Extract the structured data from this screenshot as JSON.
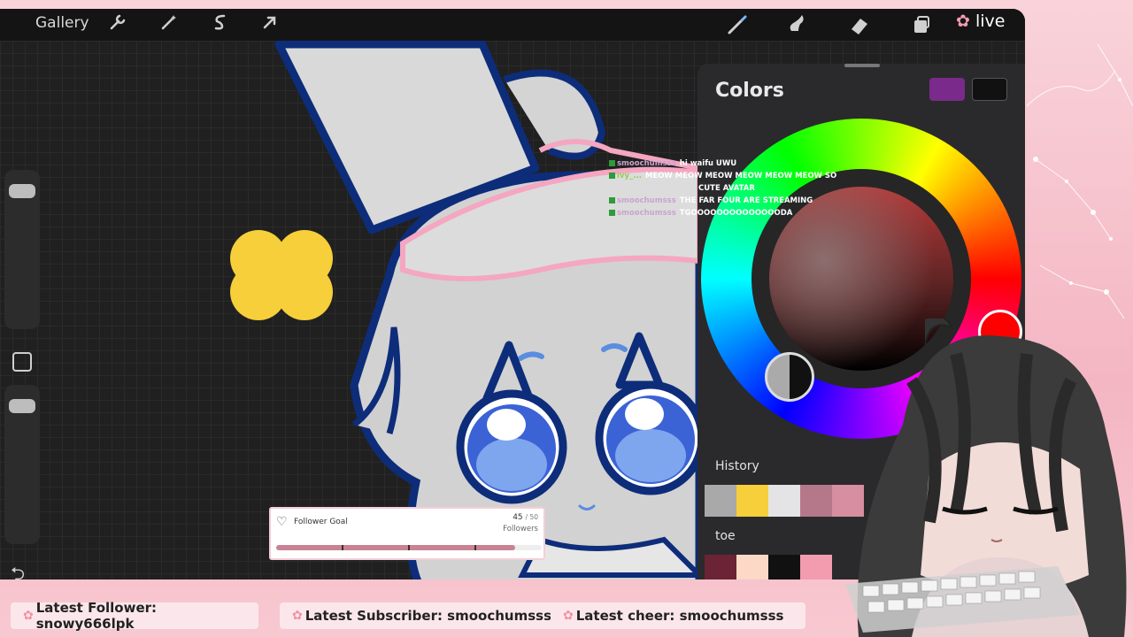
{
  "app": {
    "gallery_label": "Gallery",
    "live_label": "live",
    "live_flower": "✿"
  },
  "toolbar": {
    "left_icons": [
      "wrench-icon",
      "magic-wand-icon",
      "selection-icon",
      "transform-arrow-icon"
    ],
    "right_icons": [
      "brush-icon",
      "smudge-icon",
      "eraser-icon",
      "layers-icon"
    ]
  },
  "colors_panel": {
    "title": "Colors",
    "current_primary": "#7a2a8a",
    "current_secondary": "#111111",
    "history_label": "History",
    "history_swatches": [
      "#a9a9a9",
      "#f6cf3a",
      "#e4e4e6",
      "#b5788a",
      "#d68ea0"
    ],
    "palette_label": "toe",
    "palette_swatches": [
      "#6b2336",
      "#fbd9c6",
      "#111111",
      "#f39cb0"
    ]
  },
  "chat": [
    {
      "user": "smoochumsss",
      "message": "hi waifu UWU"
    },
    {
      "user": "ivy_...",
      "message": "MEOW MEOW MEOW MEOW MEOW MEOW SO"
    },
    {
      "user": "",
      "message": "CUTE AVATAR"
    },
    {
      "user": "smoochumsss",
      "message": "THE FAR FOUR ARE STREAMING"
    },
    {
      "user": "smoochumsss",
      "message": "TGOOOOOOOOOOOOOODA"
    }
  ],
  "follower_goal": {
    "title": "Follower Goal",
    "current": "45",
    "target": "/ 50",
    "unit": "Followers",
    "progress_fraction": 0.9
  },
  "ticker": {
    "latest_follower": "Latest Follower: snowy666lpk",
    "latest_subscriber": "Latest Subscriber: smoochumsss",
    "latest_cheer": "Latest cheer: smoochumsss"
  },
  "colors": {
    "accent_pink": "#f4b6c3",
    "canvas_bg": "#202020"
  }
}
